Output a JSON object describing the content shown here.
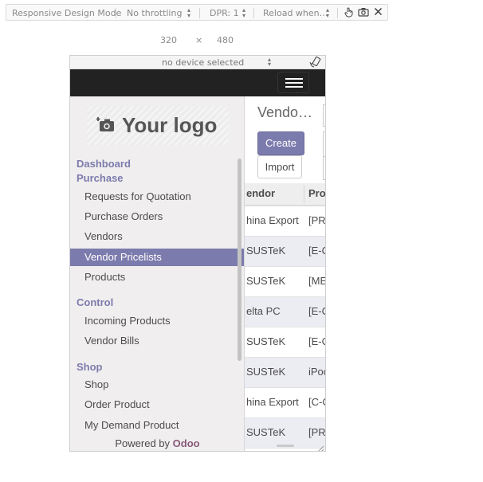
{
  "toolbar": {
    "mode_label": "Responsive Design Mode",
    "throttling": "No throttling",
    "dpr": "DPR: 1",
    "reload": "Reload when…",
    "icons": [
      "touch-icon",
      "screenshot-icon",
      "close-icon"
    ]
  },
  "viewport": {
    "width": "320",
    "separator": "×",
    "height": "480"
  },
  "device": {
    "selected": "no device selected",
    "rotate_icon": "rotate-device-icon"
  },
  "sidebar": {
    "logo_text": "Your logo",
    "logo_icon": "camera-plus-icon",
    "sections": [
      {
        "label": "Dashboard"
      },
      {
        "label": "Purchase"
      },
      {
        "label": "Control"
      },
      {
        "label": "Shop"
      }
    ],
    "items": [
      {
        "label": "Requests for Quotation"
      },
      {
        "label": "Purchase Orders"
      },
      {
        "label": "Vendors"
      },
      {
        "label": "Vendor Pricelists",
        "active": true
      },
      {
        "label": "Products"
      },
      {
        "label": "Incoming Products"
      },
      {
        "label": "Vendor Bills"
      },
      {
        "label": "Shop"
      },
      {
        "label": "Order Product"
      },
      {
        "label": "My Demand Product"
      }
    ],
    "powered_by": "Powered by",
    "powered_brand": "Odoo"
  },
  "main": {
    "title": "Vendo…",
    "create_label": "Create",
    "import_label": "Import",
    "columns": [
      "endor",
      "Pro"
    ],
    "rows": [
      {
        "vendor": "hina Export",
        "product": "[PR"
      },
      {
        "vendor": "SUSTeK",
        "product": "[E-C"
      },
      {
        "vendor": "SUSTeK",
        "product": "[ME"
      },
      {
        "vendor": "elta PC",
        "product": "[E-C"
      },
      {
        "vendor": "SUSTeK",
        "product": "[E-C"
      },
      {
        "vendor": "SUSTeK",
        "product": "iPoc"
      },
      {
        "vendor": "hina Export",
        "product": "[C-C"
      },
      {
        "vendor": "SUSTeK",
        "product": "[PR"
      }
    ]
  },
  "colors": {
    "accent": "#7c7bad",
    "navbar": "#222222",
    "brand": "#875a7b"
  }
}
